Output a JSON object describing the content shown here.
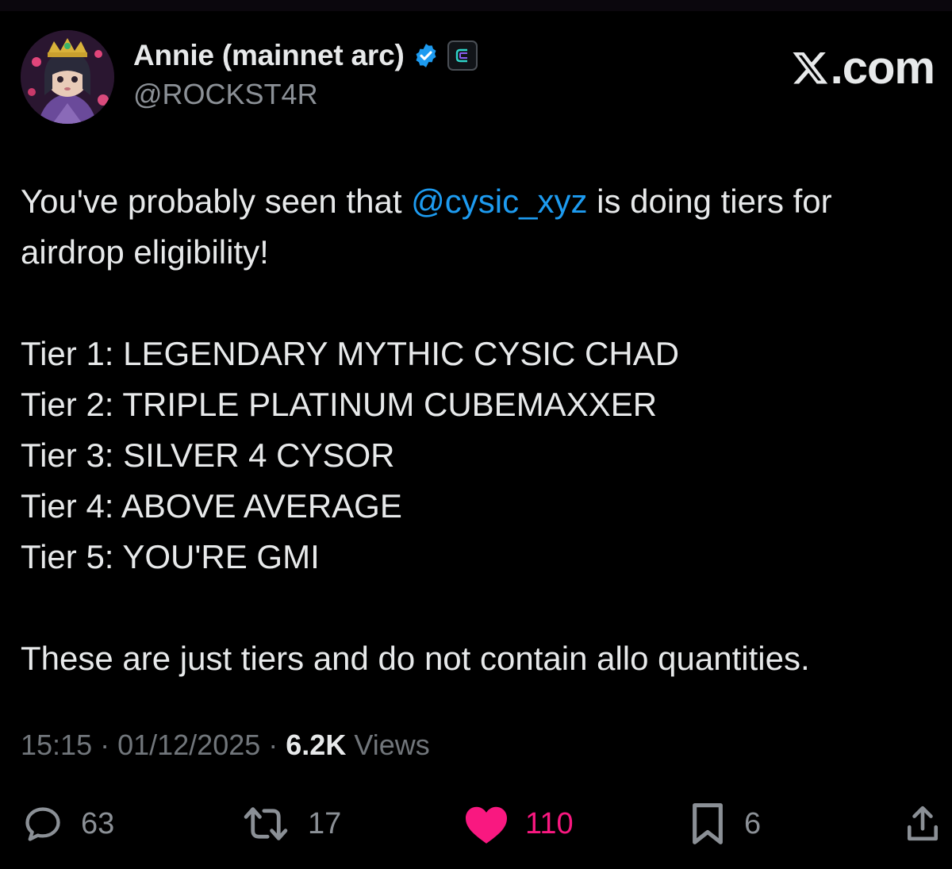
{
  "author": {
    "display_name": "Annie (mainnet arc)",
    "handle": "@ROCKST4R",
    "verified": true,
    "verified_color": "#1d9bf0",
    "affiliation_badge": "cysic-logo-icon"
  },
  "brand": {
    "label": ".com",
    "icon": "x-logo-icon"
  },
  "tweet": {
    "line1_before": "You've probably seen that ",
    "mention": "@cysic_xyz",
    "line1_after": " is doing tiers for airdrop eligibility!",
    "tiers": [
      "Tier 1: LEGENDARY MYTHIC CYSIC CHAD",
      "Tier 2: TRIPLE PLATINUM CUBEMAXXER",
      "Tier 3: SILVER 4 CYSOR",
      "Tier 4: ABOVE AVERAGE",
      "Tier 5: YOU'RE GMI"
    ],
    "closing": "These are just tiers and do not contain allo quantities."
  },
  "meta": {
    "time": "15:15",
    "separator": " · ",
    "date": "01/12/2025",
    "views_count": "6.2K",
    "views_label": " Views"
  },
  "actions": {
    "replies": "63",
    "reposts": "17",
    "likes": "110",
    "bookmarks": "6",
    "liked": true,
    "like_color": "#f91880"
  }
}
